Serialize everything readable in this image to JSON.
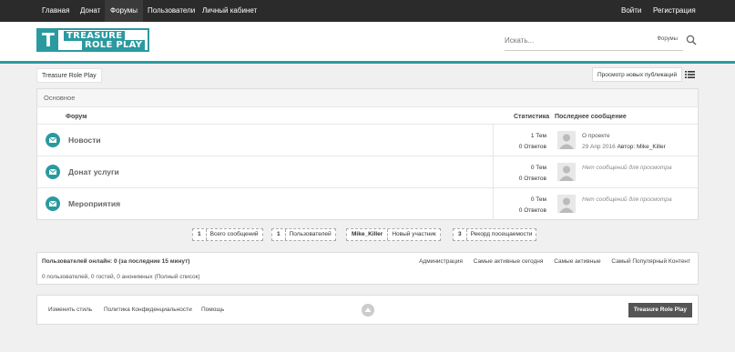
{
  "nav": {
    "items": [
      "Главная",
      "Донат",
      "Форумы",
      "Пользователи",
      "Личный кабинет"
    ],
    "login": "Войти",
    "register": "Регистрация"
  },
  "logo": {
    "letter": "T",
    "line1": "TREASURE",
    "line2": "ROLE PLAY"
  },
  "search": {
    "placeholder": "Искать...",
    "scope": "Форумы"
  },
  "breadcrumb": "Treasure Role Play",
  "new_posts_button": "Просмотр новых публикаций",
  "category": {
    "title": "Основное",
    "headers": {
      "forum": "Форум",
      "stats": "Статистика",
      "last": "Последнее сообщение"
    },
    "forums": [
      {
        "name": "Новости",
        "topics": "1 Тем",
        "replies": "0 Ответов",
        "last_title": "О проекте",
        "last_date": "29 Апр 2016",
        "author_label": "Автор:",
        "last_author": "Mike_Killer"
      },
      {
        "name": "Донат услуги",
        "topics": "0 Тем",
        "replies": "0 Ответов",
        "empty": "Нет сообщений для просмотра"
      },
      {
        "name": "Мероприятия",
        "topics": "0 Тем",
        "replies": "0 Ответов",
        "empty": "Нет сообщений для просмотра"
      }
    ]
  },
  "stats": [
    {
      "num": "1",
      "label": "Всего сообщений"
    },
    {
      "num": "1",
      "label": "Пользователей"
    },
    {
      "num": "Mike_Killer",
      "label": "Новый участник"
    },
    {
      "num": "3",
      "label": "Рекорд посещаемости"
    }
  ],
  "online": {
    "title": "Пользователей онлайн: 0 (за последние 15 минут)",
    "links": [
      "Администрация",
      "Самые активные сегодня",
      "Самые активные",
      "Самый Популярный Контент"
    ],
    "counts": "0 пользователей, 0 гостей, 0 анонимных",
    "full_list": "(Полный список)"
  },
  "footer": {
    "links": [
      "Изменить стиль",
      "Политика Конфиденциальности",
      "Помощь"
    ],
    "brand": "Treasure Role Play"
  },
  "colors": {
    "accent": "#2a9aa0",
    "nav_bg": "#2b2b2b"
  }
}
